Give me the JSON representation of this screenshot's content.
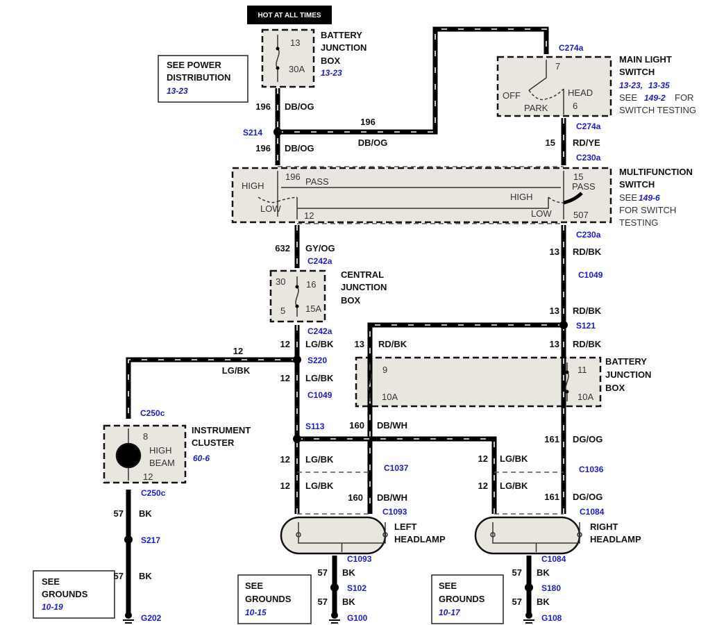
{
  "hot_label": "HOT AT ALL TIMES",
  "battery_junction_box_top": {
    "name": [
      "BATTERY",
      "JUNCTION",
      "BOX"
    ],
    "ref": "13-23",
    "cavity": "13",
    "fuse": "30A"
  },
  "see_power": {
    "lines": [
      "SEE POWER",
      "DISTRIBUTION"
    ],
    "ref": "13-23"
  },
  "main_light_switch": {
    "name": [
      "MAIN LIGHT",
      "SWITCH"
    ],
    "refs": [
      "13-23,",
      "13-35"
    ],
    "see": "SEE",
    "see_ref": "149-2",
    "for": "FOR",
    "testing": "SWITCH TESTING",
    "pin_top": "7",
    "pin_bottom": "6",
    "positions": [
      "OFF",
      "PARK",
      "HEAD"
    ]
  },
  "multifunction_switch": {
    "name": [
      "MULTIFUNCTION",
      "SWITCH"
    ],
    "see": "SEE",
    "see_ref": "149-6",
    "for": [
      "FOR SWITCH",
      "TESTING"
    ],
    "left": {
      "pin_top": "196",
      "pass": "PASS",
      "high": "HIGH",
      "low": "LOW",
      "pin_bottom": "12"
    },
    "right": {
      "pin_top": "15",
      "pass": "PASS",
      "high": "HIGH",
      "low": "LOW",
      "pin_bottom": "507"
    }
  },
  "central_junction_box": {
    "name": [
      "CENTRAL",
      "JUNCTION",
      "BOX"
    ],
    "pin_top": "30",
    "cavity": "16",
    "pin_bottom": "5",
    "fuse": "15A"
  },
  "battery_junction_box_mid": {
    "name": [
      "BATTERY",
      "JUNCTION",
      "BOX"
    ],
    "left_cavity": "9",
    "left_fuse": "10A",
    "right_cavity": "11",
    "right_fuse": "10A"
  },
  "instrument_cluster": {
    "name": [
      "INSTRUMENT",
      "CLUSTER"
    ],
    "ref": "60-6",
    "pin_top": "8",
    "pin_bottom": "12",
    "lamp": [
      "HIGH",
      "BEAM"
    ]
  },
  "left_headlamp": {
    "name": [
      "LEFT",
      "HEADLAMP"
    ]
  },
  "right_headlamp": {
    "name": [
      "RIGHT",
      "HEADLAMP"
    ]
  },
  "see_grounds": [
    {
      "lines": [
        "SEE",
        "GROUNDS"
      ],
      "ref": "10-19"
    },
    {
      "lines": [
        "SEE",
        "GROUNDS"
      ],
      "ref": "10-15"
    },
    {
      "lines": [
        "SEE",
        "GROUNDS"
      ],
      "ref": "10-17"
    }
  ],
  "connectors": {
    "c274a": "C274a",
    "c230a": "C230a",
    "c242a": "C242a",
    "c1049": "C1049",
    "c250c": "C250c",
    "c1037": "C1037",
    "c1036": "C1036",
    "c1093": "C1093",
    "c1084": "C1084"
  },
  "splices": {
    "s214": "S214",
    "s121": "S121",
    "s220": "S220",
    "s113": "S113",
    "s217": "S217",
    "s102": "S102",
    "s180": "S180"
  },
  "grounds": {
    "g202": "G202",
    "g100": "G100",
    "g108": "G108"
  },
  "wires": {
    "c196": "196",
    "dbog": "DB/OG",
    "c15": "15",
    "rdye": "RD/YE",
    "c632": "632",
    "gyog": "GY/OG",
    "c13": "13",
    "rdbk": "RD/BK",
    "c12": "12",
    "lgbk": "LG/BK",
    "c160": "160",
    "dbwh": "DB/WH",
    "c161": "161",
    "dgog": "DG/OG",
    "c57": "57",
    "bk": "BK"
  },
  "colors": {
    "reference_link": "#1a1ad0",
    "component_fill": "#e9e6e0",
    "wire": "#000000"
  }
}
